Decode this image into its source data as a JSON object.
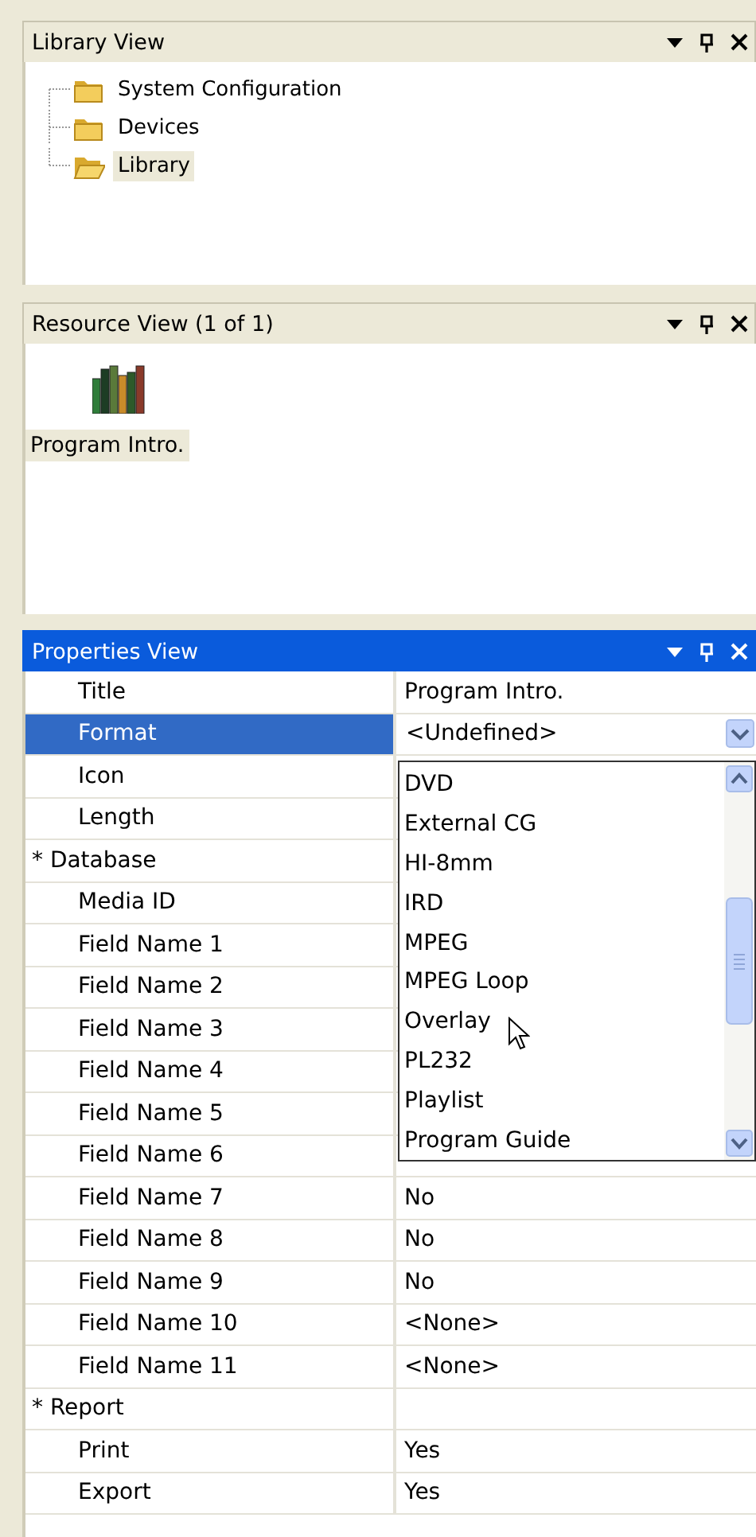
{
  "library_view": {
    "title": "Library View",
    "active": false,
    "tree": [
      {
        "label": "System Configuration",
        "selected": false
      },
      {
        "label": "Devices",
        "selected": false
      },
      {
        "label": "Library",
        "selected": true
      }
    ]
  },
  "resource_view": {
    "title": "Resource View (1 of 1)",
    "active": false,
    "items": [
      {
        "label": "Program Intro.",
        "selected": true
      }
    ]
  },
  "properties_view": {
    "title": "Properties View",
    "active": true,
    "rows": [
      {
        "kind": "property",
        "name": "Title",
        "value": "Program Intro.",
        "selected": false
      },
      {
        "kind": "combo",
        "name": "Format",
        "value": "<Undefined>",
        "selected": true
      },
      {
        "kind": "property",
        "name": "Icon",
        "selected": false
      },
      {
        "kind": "property",
        "name": "Length",
        "selected": false
      },
      {
        "kind": "group",
        "name": "* Database",
        "selected": false
      },
      {
        "kind": "property",
        "name": "Media ID",
        "selected": false
      },
      {
        "kind": "property",
        "name": "Field Name 1",
        "selected": false
      },
      {
        "kind": "property",
        "name": "Field Name 2",
        "selected": false
      },
      {
        "kind": "property",
        "name": "Field Name 3",
        "selected": false
      },
      {
        "kind": "property",
        "name": "Field Name 4",
        "selected": false
      },
      {
        "kind": "property",
        "name": "Field Name 5",
        "selected": false
      },
      {
        "kind": "property",
        "name": "Field Name 6",
        "selected": false
      },
      {
        "kind": "property",
        "name": "Field Name 7",
        "value": "No",
        "selected": false
      },
      {
        "kind": "property",
        "name": "Field Name 8",
        "value": "No",
        "selected": false
      },
      {
        "kind": "property",
        "name": "Field Name 9",
        "value": "No",
        "selected": false
      },
      {
        "kind": "property",
        "name": "Field Name 10",
        "value": "<None>",
        "selected": false
      },
      {
        "kind": "property",
        "name": "Field Name 11",
        "value": "<None>",
        "selected": false
      },
      {
        "kind": "group",
        "name": "* Report",
        "selected": false
      },
      {
        "kind": "property",
        "name": "Print",
        "value": "Yes",
        "selected": false
      },
      {
        "kind": "property",
        "name": "Export",
        "value": "Yes",
        "selected": false
      }
    ],
    "dropdown": {
      "items": [
        "DVD",
        "External CG",
        "HI-8mm",
        "IRD",
        "MPEG",
        "MPEG Loop",
        "Overlay",
        "PL232",
        "Playlist",
        "Program Guide"
      ]
    }
  }
}
